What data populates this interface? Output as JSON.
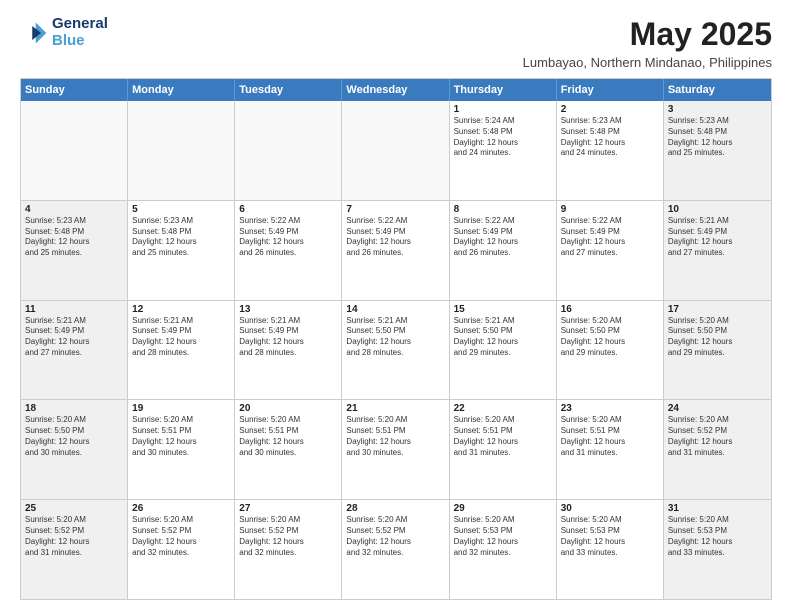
{
  "logo": {
    "line1": "General",
    "line2": "Blue"
  },
  "title": "May 2025",
  "location": "Lumbayao, Northern Mindanao, Philippines",
  "weekdays": [
    "Sunday",
    "Monday",
    "Tuesday",
    "Wednesday",
    "Thursday",
    "Friday",
    "Saturday"
  ],
  "rows": [
    [
      {
        "day": "",
        "info": "",
        "empty": true
      },
      {
        "day": "",
        "info": "",
        "empty": true
      },
      {
        "day": "",
        "info": "",
        "empty": true
      },
      {
        "day": "",
        "info": "",
        "empty": true
      },
      {
        "day": "1",
        "info": "Sunrise: 5:24 AM\nSunset: 5:48 PM\nDaylight: 12 hours\nand 24 minutes."
      },
      {
        "day": "2",
        "info": "Sunrise: 5:23 AM\nSunset: 5:48 PM\nDaylight: 12 hours\nand 24 minutes."
      },
      {
        "day": "3",
        "info": "Sunrise: 5:23 AM\nSunset: 5:48 PM\nDaylight: 12 hours\nand 25 minutes."
      }
    ],
    [
      {
        "day": "4",
        "info": "Sunrise: 5:23 AM\nSunset: 5:48 PM\nDaylight: 12 hours\nand 25 minutes."
      },
      {
        "day": "5",
        "info": "Sunrise: 5:23 AM\nSunset: 5:48 PM\nDaylight: 12 hours\nand 25 minutes."
      },
      {
        "day": "6",
        "info": "Sunrise: 5:22 AM\nSunset: 5:49 PM\nDaylight: 12 hours\nand 26 minutes."
      },
      {
        "day": "7",
        "info": "Sunrise: 5:22 AM\nSunset: 5:49 PM\nDaylight: 12 hours\nand 26 minutes."
      },
      {
        "day": "8",
        "info": "Sunrise: 5:22 AM\nSunset: 5:49 PM\nDaylight: 12 hours\nand 26 minutes."
      },
      {
        "day": "9",
        "info": "Sunrise: 5:22 AM\nSunset: 5:49 PM\nDaylight: 12 hours\nand 27 minutes."
      },
      {
        "day": "10",
        "info": "Sunrise: 5:21 AM\nSunset: 5:49 PM\nDaylight: 12 hours\nand 27 minutes."
      }
    ],
    [
      {
        "day": "11",
        "info": "Sunrise: 5:21 AM\nSunset: 5:49 PM\nDaylight: 12 hours\nand 27 minutes."
      },
      {
        "day": "12",
        "info": "Sunrise: 5:21 AM\nSunset: 5:49 PM\nDaylight: 12 hours\nand 28 minutes."
      },
      {
        "day": "13",
        "info": "Sunrise: 5:21 AM\nSunset: 5:49 PM\nDaylight: 12 hours\nand 28 minutes."
      },
      {
        "day": "14",
        "info": "Sunrise: 5:21 AM\nSunset: 5:50 PM\nDaylight: 12 hours\nand 28 minutes."
      },
      {
        "day": "15",
        "info": "Sunrise: 5:21 AM\nSunset: 5:50 PM\nDaylight: 12 hours\nand 29 minutes."
      },
      {
        "day": "16",
        "info": "Sunrise: 5:20 AM\nSunset: 5:50 PM\nDaylight: 12 hours\nand 29 minutes."
      },
      {
        "day": "17",
        "info": "Sunrise: 5:20 AM\nSunset: 5:50 PM\nDaylight: 12 hours\nand 29 minutes."
      }
    ],
    [
      {
        "day": "18",
        "info": "Sunrise: 5:20 AM\nSunset: 5:50 PM\nDaylight: 12 hours\nand 30 minutes."
      },
      {
        "day": "19",
        "info": "Sunrise: 5:20 AM\nSunset: 5:51 PM\nDaylight: 12 hours\nand 30 minutes."
      },
      {
        "day": "20",
        "info": "Sunrise: 5:20 AM\nSunset: 5:51 PM\nDaylight: 12 hours\nand 30 minutes."
      },
      {
        "day": "21",
        "info": "Sunrise: 5:20 AM\nSunset: 5:51 PM\nDaylight: 12 hours\nand 30 minutes."
      },
      {
        "day": "22",
        "info": "Sunrise: 5:20 AM\nSunset: 5:51 PM\nDaylight: 12 hours\nand 31 minutes."
      },
      {
        "day": "23",
        "info": "Sunrise: 5:20 AM\nSunset: 5:51 PM\nDaylight: 12 hours\nand 31 minutes."
      },
      {
        "day": "24",
        "info": "Sunrise: 5:20 AM\nSunset: 5:52 PM\nDaylight: 12 hours\nand 31 minutes."
      }
    ],
    [
      {
        "day": "25",
        "info": "Sunrise: 5:20 AM\nSunset: 5:52 PM\nDaylight: 12 hours\nand 31 minutes."
      },
      {
        "day": "26",
        "info": "Sunrise: 5:20 AM\nSunset: 5:52 PM\nDaylight: 12 hours\nand 32 minutes."
      },
      {
        "day": "27",
        "info": "Sunrise: 5:20 AM\nSunset: 5:52 PM\nDaylight: 12 hours\nand 32 minutes."
      },
      {
        "day": "28",
        "info": "Sunrise: 5:20 AM\nSunset: 5:52 PM\nDaylight: 12 hours\nand 32 minutes."
      },
      {
        "day": "29",
        "info": "Sunrise: 5:20 AM\nSunset: 5:53 PM\nDaylight: 12 hours\nand 32 minutes."
      },
      {
        "day": "30",
        "info": "Sunrise: 5:20 AM\nSunset: 5:53 PM\nDaylight: 12 hours\nand 33 minutes."
      },
      {
        "day": "31",
        "info": "Sunrise: 5:20 AM\nSunset: 5:53 PM\nDaylight: 12 hours\nand 33 minutes."
      }
    ]
  ]
}
